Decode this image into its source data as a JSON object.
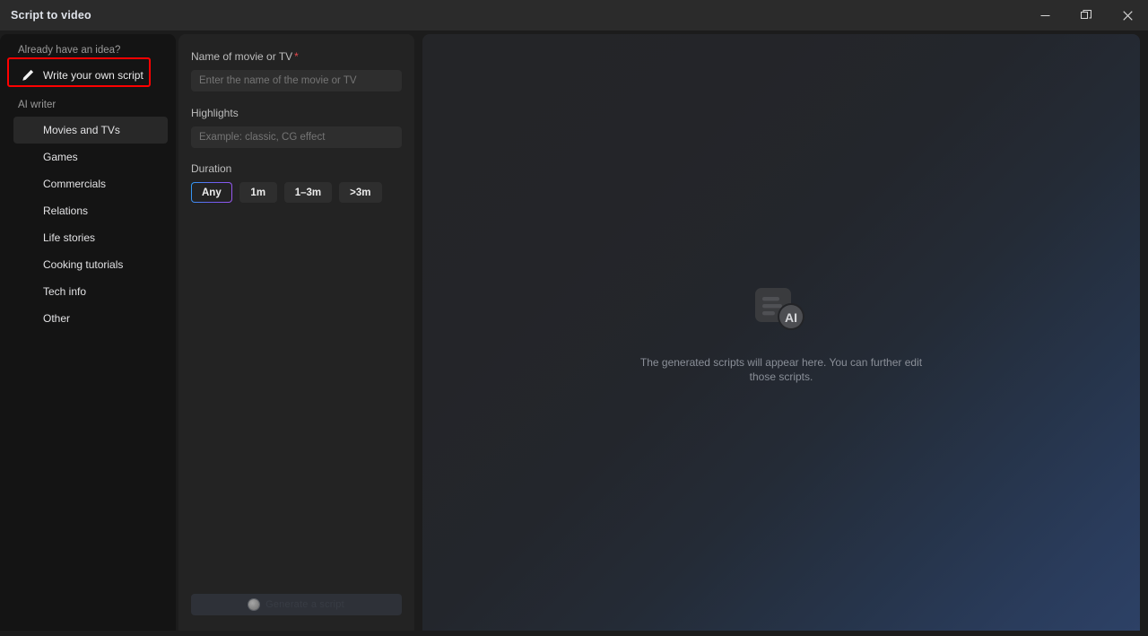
{
  "window": {
    "title": "Script to video",
    "controls": [
      {
        "name": "minimize-button",
        "label": "─"
      },
      {
        "name": "restore-button",
        "label": "❐"
      },
      {
        "name": "close-button",
        "label": "✕"
      }
    ]
  },
  "sidebar": {
    "idea_label": "Already have an idea?",
    "own_script": {
      "label": "Write your own script",
      "icon": "pencil-icon",
      "highlight_color": "#ff0000"
    },
    "ai_writer_label": "AI writer",
    "items": [
      {
        "label": "Movies and TVs",
        "active": true
      },
      {
        "label": "Games",
        "active": false
      },
      {
        "label": "Commercials",
        "active": false
      },
      {
        "label": "Relations",
        "active": false
      },
      {
        "label": "Life stories",
        "active": false
      },
      {
        "label": "Cooking tutorials",
        "active": false
      },
      {
        "label": "Tech info",
        "active": false
      },
      {
        "label": "Other",
        "active": false
      }
    ]
  },
  "form": {
    "name_label": "Name of movie or TV",
    "name_required_mark": "*",
    "name_value": "",
    "name_placeholder": "Enter the name of the movie or TV",
    "highlights_label": "Highlights",
    "highlights_value": "",
    "highlights_placeholder": "Example: classic, CG effect",
    "duration_label": "Duration",
    "duration_options": [
      {
        "label": "Any",
        "selected": true
      },
      {
        "label": "1m",
        "selected": false
      },
      {
        "label": "1–3m",
        "selected": false
      },
      {
        "label": ">3m",
        "selected": false
      }
    ],
    "generate_button": {
      "label": "Generate a script",
      "state": "loading",
      "icon": "loading-spinner-icon"
    }
  },
  "preview": {
    "icon": "ai-document-icon",
    "icon_badge_text": "AI",
    "empty_text": "The generated scripts will appear here. You can further edit those scripts."
  },
  "colors": {
    "titlebar": "#2b2b2b",
    "sidebar": "#141414",
    "form_panel": "#232323",
    "input": "#2e2e2e",
    "accent_gradient_start": "#2f9bf2",
    "accent_gradient_end": "#9a58ef",
    "required_mark": "#e5484d",
    "annotation": "#ff0000"
  }
}
